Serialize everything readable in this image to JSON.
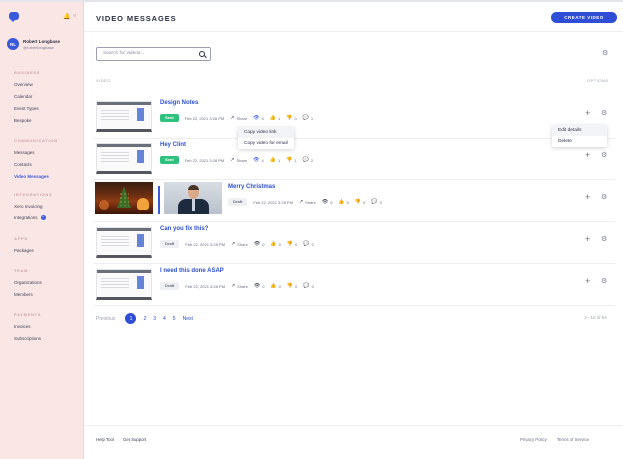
{
  "app": {
    "title": "VIDEO MESSAGES",
    "create_button": "CREATE VIDEO",
    "accent": "#2e4ed6",
    "sidebar_bg": "#fbe6e6"
  },
  "user": {
    "initials": "RL",
    "name": "Robert Longbase",
    "handle": "@robertlongbase"
  },
  "sidebar": {
    "sections": [
      {
        "label": "BUSINESS",
        "items": [
          "Overview",
          "Calendar",
          "Event Types",
          "Bespoke"
        ]
      },
      {
        "label": "COMMUNICATION",
        "items": [
          "Messages",
          "Contacts",
          "Video Messages"
        ]
      },
      {
        "label": "INTEGRATIONS",
        "items": [
          "Xero Invoicing",
          "Integrations"
        ]
      },
      {
        "label": "APPS",
        "items": [
          "Packages"
        ]
      },
      {
        "label": "TEAM",
        "items": [
          "Organizations",
          "Members"
        ]
      },
      {
        "label": "PAYMENTS",
        "items": [
          "Invoices",
          "Subscriptions"
        ]
      }
    ],
    "active_item": "Video Messages",
    "integrations_badge": "+"
  },
  "search": {
    "placeholder": "Search for videos..."
  },
  "columns": {
    "video": "VIDEO",
    "options": "OPTIONS"
  },
  "videos": [
    {
      "title": "Design Notes",
      "status": "Sent",
      "date": "Feb 22, 2021 3:28 PM",
      "share": "Share",
      "views": "4",
      "likes": "1",
      "dislikes": "0",
      "comments": "1"
    },
    {
      "title": "Hey Clint",
      "status": "Sent",
      "date": "Feb 22, 2021 3:28 PM",
      "share": "Share",
      "views": "4",
      "likes": "1",
      "dislikes": "1",
      "comments": "2"
    },
    {
      "title": "Merry Christmas",
      "status": "Draft",
      "date": "Feb 22, 2021 3:28 PM",
      "share": "Share",
      "views": "0",
      "likes": "0",
      "dislikes": "0",
      "comments": "0"
    },
    {
      "title": "Can you fix this?",
      "status": "Draft",
      "date": "Feb 22, 2021 3:28 PM",
      "share": "Share",
      "views": "0",
      "likes": "0",
      "dislikes": "0",
      "comments": "0"
    },
    {
      "title": "I need this done ASAP",
      "status": "Draft",
      "date": "Feb 22, 2021 3:28 PM",
      "share": "Share",
      "views": "0",
      "likes": "0",
      "dislikes": "0",
      "comments": "0"
    }
  ],
  "share_menu": {
    "items": [
      "Copy video link",
      "Copy video for email"
    ]
  },
  "options_menu": {
    "items": [
      "Edit details",
      "Delete"
    ]
  },
  "pagination": {
    "previous": "Previous",
    "pages": [
      "1",
      "2",
      "3",
      "4",
      "5"
    ],
    "current": "1",
    "next": "Next",
    "range": "1 - 10 of 54"
  },
  "footer": {
    "help": "Help Tool",
    "support": "Get Support",
    "privacy": "Privacy Policy",
    "terms": "Terms of Service"
  }
}
